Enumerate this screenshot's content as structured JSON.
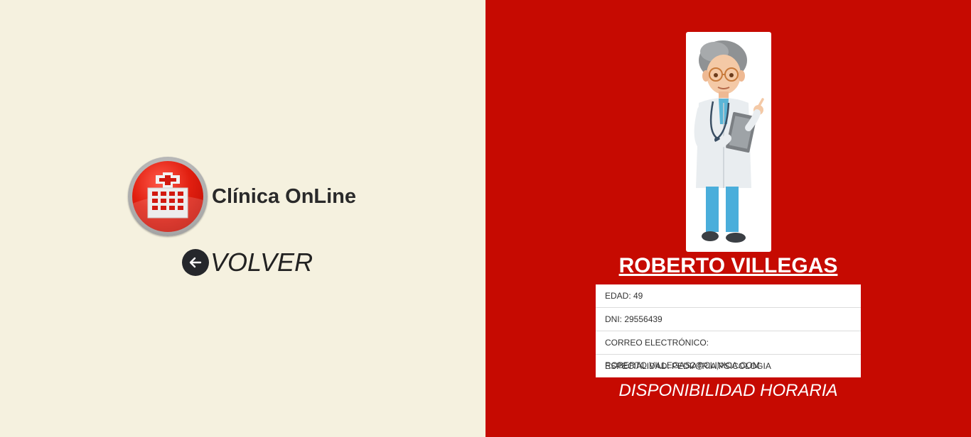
{
  "brand": {
    "name": "Clínica OnLine",
    "logo_icon": "hospital-icon"
  },
  "back": {
    "label": "VOLVER",
    "icon": "arrow-left-icon"
  },
  "doctor": {
    "name": "ROBERTO VILLEGAS",
    "photo_icon": "doctor-avatar-icon",
    "details": [
      "EDAD: 49",
      "DNI: 29556439",
      "CORREO ELECTRÓNICO: ROBERTO.VILLEGAS2@CLINICA.COM",
      "ESPECIALIDAD: PEDIATRIA,PSICOLOGIA"
    ]
  },
  "availability": {
    "title": "DISPONIBILIDAD HORARIA"
  },
  "colors": {
    "left_bg": "#f5f1df",
    "right_bg": "#c60a01",
    "text_dark": "#222222"
  }
}
